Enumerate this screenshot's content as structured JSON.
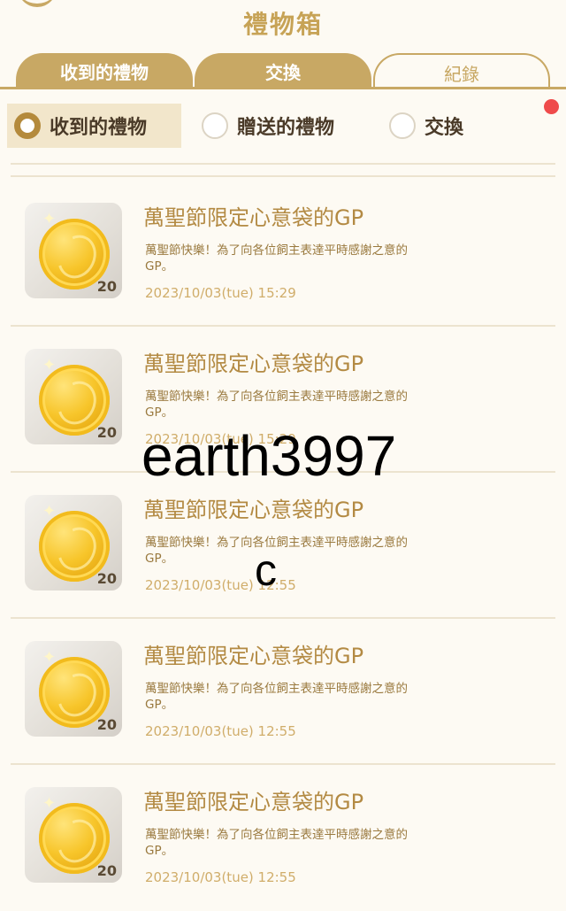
{
  "header": {
    "title": "禮物箱"
  },
  "tabs": [
    {
      "label": "收到的禮物",
      "active": false
    },
    {
      "label": "交換",
      "active": false
    },
    {
      "label": "紀錄",
      "active": true
    }
  ],
  "filters": [
    {
      "label": "收到的禮物",
      "selected": true
    },
    {
      "label": "贈送的禮物",
      "selected": false
    },
    {
      "label": "交換",
      "selected": false
    }
  ],
  "items": [
    {
      "title": "萬聖節限定心意袋的GP",
      "desc": "萬聖節快樂！為了向各位飼主表達平時感謝之意的GP。",
      "count": "20",
      "time": "2023/10/03(tue) 15:29",
      "icon": "gold-coin-icon"
    },
    {
      "title": "萬聖節限定心意袋的GP",
      "desc": "萬聖節快樂！為了向各位飼主表達平時感謝之意的GP。",
      "count": "20",
      "time": "2023/10/03(tue) 15:29",
      "icon": "gold-coin-icon"
    },
    {
      "title": "萬聖節限定心意袋的GP",
      "desc": "萬聖節快樂！為了向各位飼主表達平時感謝之意的GP。",
      "count": "20",
      "time": "2023/10/03(tue) 12:55",
      "icon": "gold-coin-icon"
    },
    {
      "title": "萬聖節限定心意袋的GP",
      "desc": "萬聖節快樂！為了向各位飼主表達平時感謝之意的GP。",
      "count": "20",
      "time": "2023/10/03(tue) 12:55",
      "icon": "gold-coin-icon"
    },
    {
      "title": "萬聖節限定心意袋的GP",
      "desc": "萬聖節快樂！為了向各位飼主表達平時感謝之意的GP。",
      "count": "20",
      "time": "2023/10/03(tue) 12:55",
      "icon": "gold-coin-icon"
    }
  ],
  "watermark": {
    "line1": "earth3997",
    "line2": "c"
  },
  "colors": {
    "accent": "#c8a864",
    "notification": "#ef4b4b",
    "selected_bg": "#f2e6cb"
  }
}
